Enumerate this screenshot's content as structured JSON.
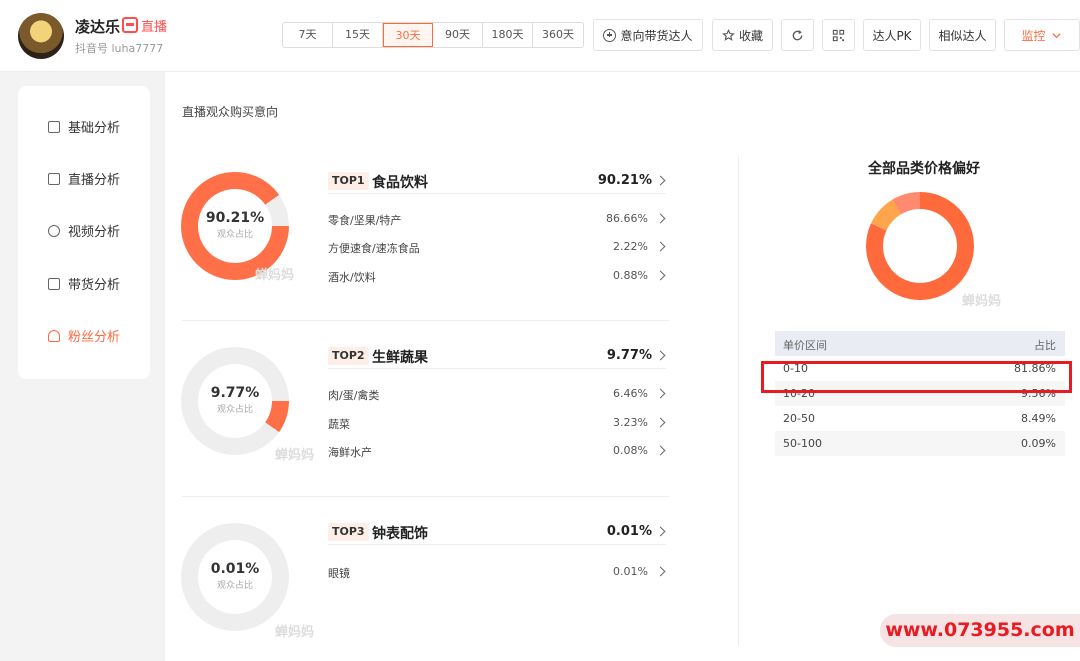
{
  "profile": {
    "name": "凌达乐",
    "live_badge": "直播",
    "account": "抖音号 luha7777"
  },
  "ranges": [
    {
      "label": "7天",
      "active": false
    },
    {
      "label": "15天",
      "active": false
    },
    {
      "label": "30天",
      "active": true
    },
    {
      "label": "90天",
      "active": false
    },
    {
      "label": "180天",
      "active": false
    },
    {
      "label": "360天",
      "active": false
    }
  ],
  "header_buttons": {
    "intent": "意向带货达人",
    "favorite": "收藏",
    "pk": "达人PK",
    "similar": "相似达人",
    "monitor": "监控"
  },
  "sidebar": {
    "items": [
      {
        "label": "基础分析",
        "icon": "chart-icon",
        "active": false
      },
      {
        "label": "直播分析",
        "icon": "live-icon",
        "active": false
      },
      {
        "label": "视频分析",
        "icon": "video-icon",
        "active": false
      },
      {
        "label": "带货分析",
        "icon": "bag-icon",
        "active": false
      },
      {
        "label": "粉丝分析",
        "icon": "user-icon",
        "active": true
      }
    ]
  },
  "main": {
    "section_title": "直播观众购买意向",
    "donut_caption": "观众占比",
    "watermark": "蝉妈妈",
    "accent_color": "#ff6f48",
    "categories": [
      {
        "rank": "TOP1",
        "name": "食品饮料",
        "pct": "90.21%",
        "share": 90.21,
        "subs": [
          {
            "name": "零食/坚果/特产",
            "pct": "86.66%"
          },
          {
            "name": "方便速食/速冻食品",
            "pct": "2.22%"
          },
          {
            "name": "酒水/饮料",
            "pct": "0.88%"
          }
        ]
      },
      {
        "rank": "TOP2",
        "name": "生鲜蔬果",
        "pct": "9.77%",
        "share": 9.77,
        "subs": [
          {
            "name": "肉/蛋/禽类",
            "pct": "6.46%"
          },
          {
            "name": "蔬菜",
            "pct": "3.23%"
          },
          {
            "name": "海鲜水产",
            "pct": "0.08%"
          }
        ]
      },
      {
        "rank": "TOP3",
        "name": "钟表配饰",
        "pct": "0.01%",
        "share": 0.01,
        "subs": [
          {
            "name": "眼镜",
            "pct": "0.01%"
          }
        ]
      }
    ]
  },
  "price_pref": {
    "title": "全部品类价格偏好",
    "colors": [
      "#ff6a3d",
      "#ffa64d",
      "#ff8a70",
      "#ffc2a8"
    ],
    "table_header": {
      "range": "单价区间",
      "share": "占比"
    },
    "rows": [
      {
        "range": "0-10",
        "share": "81.86%",
        "value": 81.86
      },
      {
        "range": "10-20",
        "share": "9.56%",
        "value": 9.56
      },
      {
        "range": "20-50",
        "share": "8.49%",
        "value": 8.49
      },
      {
        "range": "50-100",
        "share": "0.09%",
        "value": 0.09
      }
    ]
  },
  "site_watermark": "www.073955.com"
}
